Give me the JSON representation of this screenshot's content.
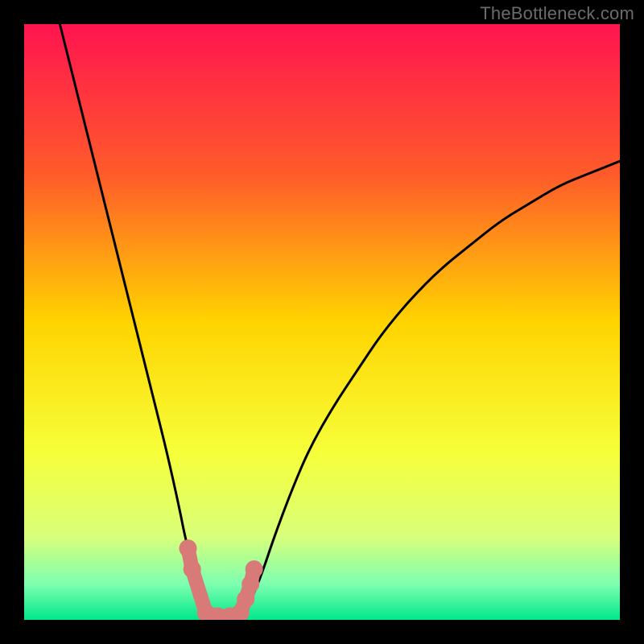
{
  "watermark": {
    "text": "TheBottleneck.com"
  },
  "chart_data": {
    "type": "line",
    "title": "",
    "xlabel": "",
    "ylabel": "",
    "xlim": [
      0,
      100
    ],
    "ylim": [
      0,
      100
    ],
    "gradient_stops": [
      {
        "offset": 0.0,
        "color": "#ff1450"
      },
      {
        "offset": 0.25,
        "color": "#ff5a2a"
      },
      {
        "offset": 0.5,
        "color": "#ffd400"
      },
      {
        "offset": 0.72,
        "color": "#f6ff3a"
      },
      {
        "offset": 0.86,
        "color": "#d8ff7a"
      },
      {
        "offset": 0.94,
        "color": "#7dffb0"
      },
      {
        "offset": 1.0,
        "color": "#00e88a"
      }
    ],
    "series": [
      {
        "name": "left-branch",
        "x": [
          6,
          8,
          10,
          12,
          14,
          16,
          18,
          20,
          22,
          24,
          26,
          27,
          28,
          29,
          30,
          31
        ],
        "y": [
          100,
          92,
          84,
          76,
          68,
          60,
          52,
          44,
          36,
          28,
          19,
          14,
          10,
          6,
          3,
          1
        ]
      },
      {
        "name": "right-branch",
        "x": [
          37,
          38,
          40,
          42,
          45,
          48,
          52,
          56,
          60,
          65,
          70,
          75,
          80,
          85,
          90,
          95,
          100
        ],
        "y": [
          1,
          3,
          8,
          14,
          22,
          29,
          36,
          42,
          48,
          54,
          59,
          63,
          67,
          70,
          73,
          75,
          77
        ]
      },
      {
        "name": "valley-floor",
        "x": [
          31,
          32,
          33,
          34,
          35,
          36,
          37
        ],
        "y": [
          1,
          0.3,
          0,
          0,
          0,
          0.3,
          1
        ]
      }
    ],
    "markers": [
      {
        "name": "left-lobe-top",
        "x": 27.5,
        "y": 12
      },
      {
        "name": "left-lobe-bottom",
        "x": 28.2,
        "y": 8.5
      },
      {
        "name": "floor-1",
        "x": 30.5,
        "y": 1.2
      },
      {
        "name": "floor-2",
        "x": 32.5,
        "y": 0.6
      },
      {
        "name": "floor-3",
        "x": 34.5,
        "y": 0.6
      },
      {
        "name": "right-1",
        "x": 36.3,
        "y": 1.2
      },
      {
        "name": "right-2",
        "x": 37.2,
        "y": 3.5
      },
      {
        "name": "right-3",
        "x": 38.0,
        "y": 6.0
      },
      {
        "name": "right-4",
        "x": 38.6,
        "y": 8.5
      }
    ],
    "marker_color": "#d77a78",
    "marker_link_color": "#d77a78",
    "curve_color": "#000000"
  }
}
